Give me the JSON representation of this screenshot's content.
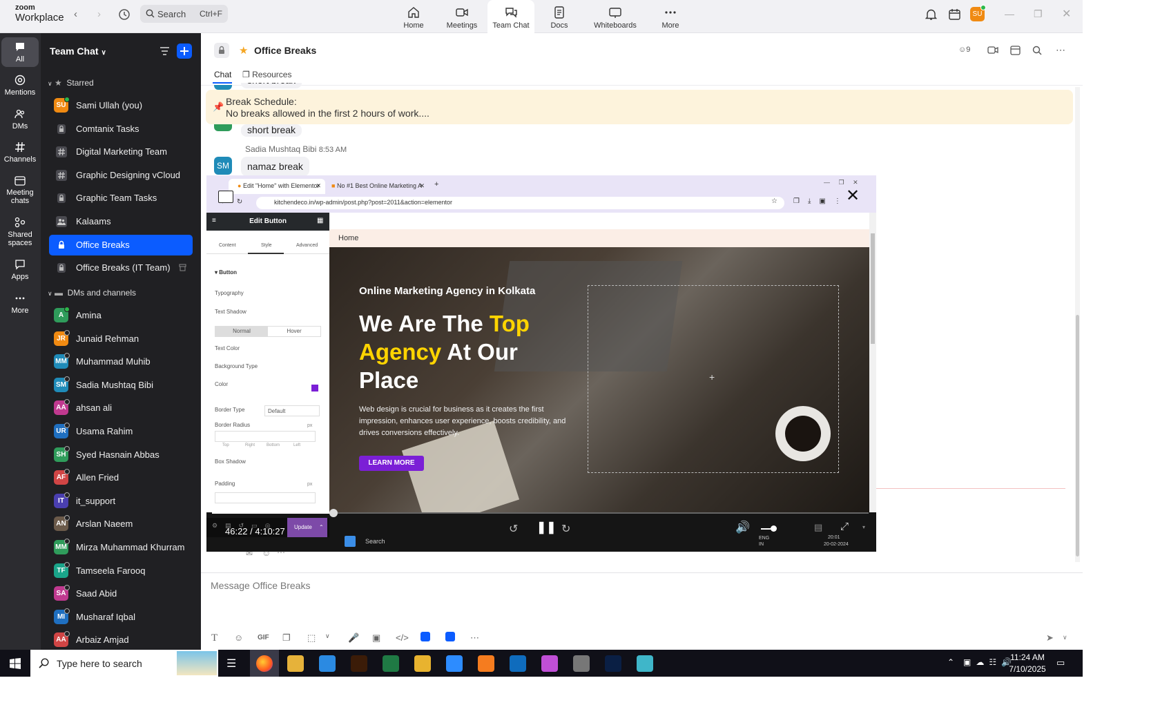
{
  "app": {
    "brand_top": "zoom",
    "brand_bottom": "Workplace"
  },
  "search": {
    "label": "Search",
    "shortcut": "Ctrl+F"
  },
  "tabs": [
    {
      "label": "Home"
    },
    {
      "label": "Meetings"
    },
    {
      "label": "Team Chat"
    },
    {
      "label": "Docs"
    },
    {
      "label": "Whiteboards"
    },
    {
      "label": "More"
    }
  ],
  "user_initials": "SU",
  "rail": [
    {
      "label": "All"
    },
    {
      "label": "Mentions"
    },
    {
      "label": "DMs"
    },
    {
      "label": "Channels"
    },
    {
      "label": "Meeting chats"
    },
    {
      "label": "Shared spaces"
    },
    {
      "label": "Apps"
    },
    {
      "label": "More"
    }
  ],
  "sidebar": {
    "title": "Team Chat",
    "starred_header": "Starred",
    "starred": [
      {
        "label": "Sami Ullah (you)",
        "initials": "SU",
        "color": "#f08a12",
        "kind": "avatar"
      },
      {
        "label": "Comtanix Tasks",
        "kind": "lock"
      },
      {
        "label": "Digital Marketing Team",
        "kind": "hash"
      },
      {
        "label": "Graphic Designing vCloud",
        "kind": "hash"
      },
      {
        "label": "Graphic Team Tasks",
        "kind": "lock"
      },
      {
        "label": "Kalaams",
        "kind": "people"
      },
      {
        "label": "Office Breaks",
        "kind": "lock"
      },
      {
        "label": "Office Breaks (IT Team)",
        "kind": "lock"
      }
    ],
    "dms_header": "DMs and channels",
    "dms": [
      {
        "label": "Amina",
        "initials": "A",
        "color": "#2f9c5b"
      },
      {
        "label": "Junaid Rehman",
        "initials": "JR",
        "color": "#f08a12"
      },
      {
        "label": "Muhammad Muhib",
        "initials": "MM",
        "color": "#1f8bb8"
      },
      {
        "label": "Sadia Mushtaq Bibi",
        "initials": "SM",
        "color": "#1f8bb8"
      },
      {
        "label": "ahsan ali",
        "initials": "AA",
        "color": "#c0398f"
      },
      {
        "label": "Usama Rahim",
        "initials": "UR",
        "color": "#1f6fc0"
      },
      {
        "label": "Syed Hasnain Abbas",
        "initials": "SH",
        "color": "#2f9c5b"
      },
      {
        "label": "Allen Fried",
        "initials": "AF",
        "color": "#d04545"
      },
      {
        "label": "it_support",
        "initials": "IT",
        "color": "#4a3fb0"
      },
      {
        "label": "Arslan Naeem",
        "initials": "AN",
        "color": "#6b5a4a"
      },
      {
        "label": "Mirza Muhammad Khurram",
        "initials": "MM",
        "color": "#2f9c5b"
      },
      {
        "label": "Tamseela Farooq",
        "initials": "TF",
        "color": "#1aa58a"
      },
      {
        "label": "Saad Abid",
        "initials": "SA",
        "color": "#c0398f"
      },
      {
        "label": "Musharaf Iqbal",
        "initials": "MI",
        "color": "#1f6fc0"
      },
      {
        "label": "Arbaiz Amjad",
        "initials": "AA",
        "color": "#d04545"
      }
    ]
  },
  "channel": {
    "title": "Office Breaks",
    "member_count": "9",
    "subtabs": [
      {
        "label": "Chat"
      },
      {
        "label": "Resources"
      }
    ],
    "pinned_title": "Break Schedule:",
    "pinned_text": "No breaks allowed in the first 2 hours of work....",
    "partial_msg": "short break",
    "msg2": "short break",
    "msg3_sender": "Sadia Mushtaq Bibi",
    "msg3_time": "8:53 AM",
    "msg3_initials": "SM",
    "msg3_text": "namaz break",
    "compose_placeholder": "Message Office Breaks"
  },
  "video": {
    "time": "46:22 / 4:10:27",
    "progress": 0.185,
    "browser_tab1": "Edit \"Home\" with Elementor",
    "browser_tab2": "No #1 Best Online Marketing A",
    "url": "kitchendeco.in/wp-admin/post.php?post=2011&action=elementor",
    "panel_title": "Edit Button",
    "panel_tabs": [
      "Content",
      "Style",
      "Advanced"
    ],
    "panel_section": "Button",
    "panel_rows": [
      "Typography",
      "Text Shadow",
      "Text Color",
      "Background Type",
      "Color",
      "Border Type",
      "Border Radius",
      "Box Shadow",
      "Padding"
    ],
    "normal": "Normal",
    "hover": "Hover",
    "border_default": "Default",
    "dims": [
      "Top",
      "Right",
      "Bottom",
      "Left"
    ],
    "px": "px",
    "update": "Update",
    "breadcrumb": "Home",
    "hero_kicker": "Online Marketing Agency in Kolkata",
    "hero_l1a": "We Are The ",
    "hero_l1b": "Top",
    "hero_l2a": "Agency",
    "hero_l2b": " At Our",
    "hero_l3": "Place",
    "hero_body": "Web design is crucial for business as it creates the first impression, enhances user experience, boosts credibility, and drives conversions effectively.",
    "cta": "LEARN MORE",
    "inner_search": "Search",
    "inner_lang": "ENG IN",
    "inner_time": "20:01",
    "inner_date": "20-02-2024"
  },
  "taskbar": {
    "search_placeholder": "Type here to search",
    "time": "11:24 AM",
    "date": "7/10/2025"
  }
}
